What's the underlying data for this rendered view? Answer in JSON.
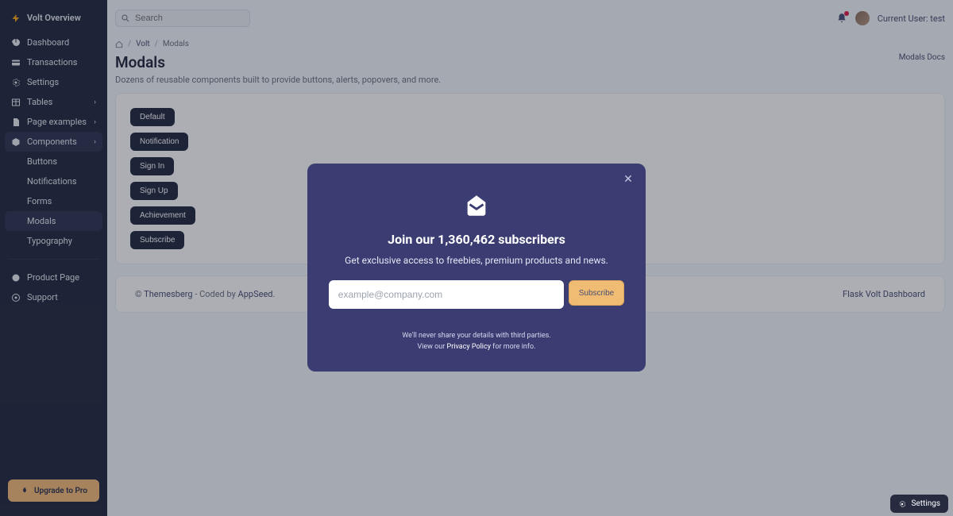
{
  "brand": {
    "name": "Volt Overview"
  },
  "search": {
    "placeholder": "Search"
  },
  "user": {
    "label": "Current User: test"
  },
  "sidebar": {
    "items": [
      {
        "label": "Dashboard"
      },
      {
        "label": "Transactions"
      },
      {
        "label": "Settings"
      },
      {
        "label": "Tables"
      },
      {
        "label": "Page examples"
      },
      {
        "label": "Components"
      }
    ],
    "sub": [
      {
        "label": "Buttons"
      },
      {
        "label": "Notifications"
      },
      {
        "label": "Forms"
      },
      {
        "label": "Modals"
      },
      {
        "label": "Typography"
      }
    ],
    "extra": [
      {
        "label": "Product Page"
      },
      {
        "label": "Support"
      }
    ],
    "upgrade": "Upgrade to Pro"
  },
  "breadcrumb": {
    "volt": "Volt",
    "current": "Modals"
  },
  "page": {
    "title": "Modals",
    "desc": "Dozens of reusable components built to provide buttons, alerts, popovers, and more.",
    "docs": "Modals Docs"
  },
  "buttons": [
    "Default",
    "Notification",
    "Sign In",
    "Sign Up",
    "Achievement",
    "Subscribe"
  ],
  "footer": {
    "left_prefix": "© ",
    "left_brand": "Themesberg",
    "left_mid": " - Coded by ",
    "left_app": "AppSeed",
    "left_suffix": ".",
    "right": "Flask Volt Dashboard"
  },
  "modal": {
    "title": "Join our 1,360,462 subscribers",
    "sub": "Get exclusive access to freebies, premium products and news.",
    "placeholder": "example@company.com",
    "button": "Subscribe",
    "fine1": "We'll never share your details with third parties.",
    "fine2a": "View our ",
    "fine2_link": "Privacy Policy",
    "fine2b": " for more info."
  },
  "fab": {
    "label": "Settings"
  }
}
